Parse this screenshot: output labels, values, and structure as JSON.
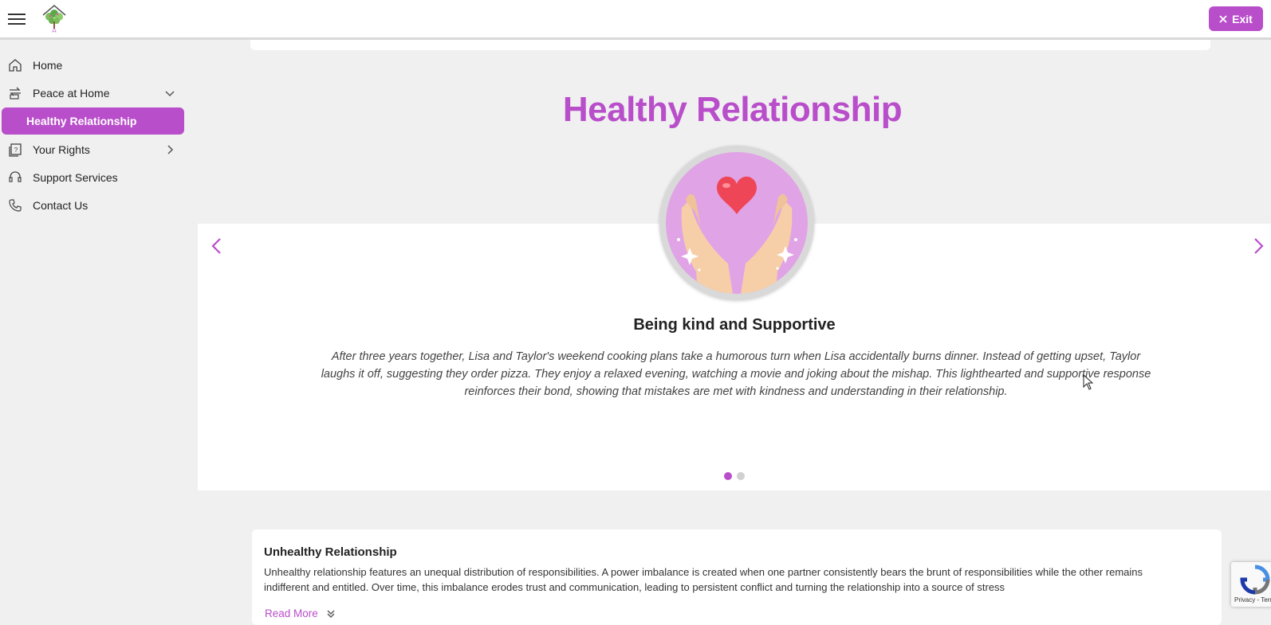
{
  "header": {
    "exit_label": "Exit",
    "accent_color": "#b94ecb"
  },
  "sidebar": {
    "items": [
      {
        "label": "Home",
        "icon": "home-icon"
      },
      {
        "label": "Peace at Home",
        "icon": "peace-icon",
        "expanded": true
      },
      {
        "label": "Healthy Relationship",
        "active": true
      },
      {
        "label": "Your Rights",
        "icon": "rights-icon"
      },
      {
        "label": "Support Services",
        "icon": "support-icon"
      },
      {
        "label": "Contact Us",
        "icon": "phone-icon"
      }
    ]
  },
  "main": {
    "title": "Healthy Relationship",
    "slide": {
      "title": "Being kind and Supportive",
      "text": "After three years together, Lisa and Taylor's weekend cooking plans take a humorous turn when Lisa accidentally burns dinner. Instead of getting upset, Taylor laughs it off, suggesting they order pizza. They enjoy a relaxed evening, watching a movie and joking about the mishap. This lighthearted and supportive response reinforces their bond, showing that mistakes are met with kindness and understanding in their relationship.",
      "dots": 2,
      "active_dot": 1
    },
    "card": {
      "title": "Unhealthy Relationship",
      "text": "Unhealthy relationship features an unequal distribution of responsibilities. A power imbalance is created when one partner consistently bears the brunt of responsibilities while the other remains indifferent and entitled. Over time, this imbalance erodes trust and communication, leading to persistent conflict and turning the relationship into a source of stress",
      "read_more": "Read More"
    }
  },
  "recaptcha": {
    "terms": "Privacy - Terms"
  }
}
